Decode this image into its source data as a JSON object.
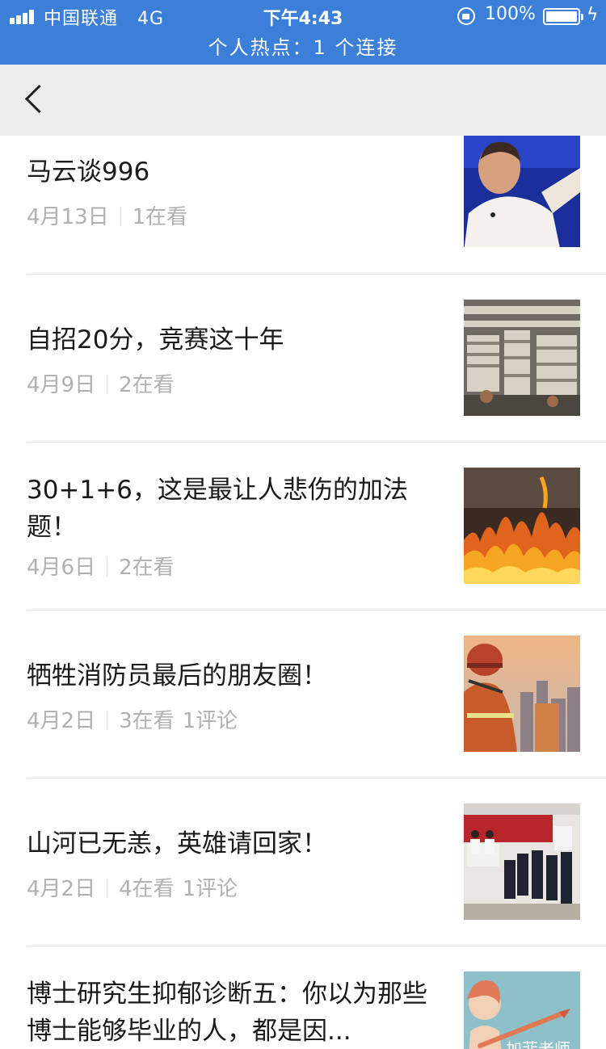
{
  "status_bar": {
    "carrier": "中国联通",
    "network": "4G",
    "time": "下午4:43",
    "battery": "100%",
    "hotspot": "个人热点：1 个连接"
  },
  "nav": {
    "back_icon": "chevron-left-icon"
  },
  "articles": [
    {
      "title": "马云谈996",
      "date": "4月13日",
      "views": "1在看",
      "comments": ""
    },
    {
      "title": "自招20分，竞赛这十年",
      "date": "4月9日",
      "views": "2在看",
      "comments": ""
    },
    {
      "title": "30+1+6，这是最让人悲伤的加法题！",
      "date": "4月6日",
      "views": "2在看",
      "comments": ""
    },
    {
      "title": "牺牲消防员最后的朋友圈！",
      "date": "4月2日",
      "views": "3在看",
      "comments": "1评论"
    },
    {
      "title": "山河已无恙，英雄请回家！",
      "date": "4月2日",
      "views": "4在看",
      "comments": "1评论"
    },
    {
      "title": "博士研究生抑郁诊断五：你以为那些博士能够毕业的人，都是因...",
      "date": "",
      "views": "",
      "comments": ""
    }
  ],
  "thumbnail_watermark": "加菲老师"
}
